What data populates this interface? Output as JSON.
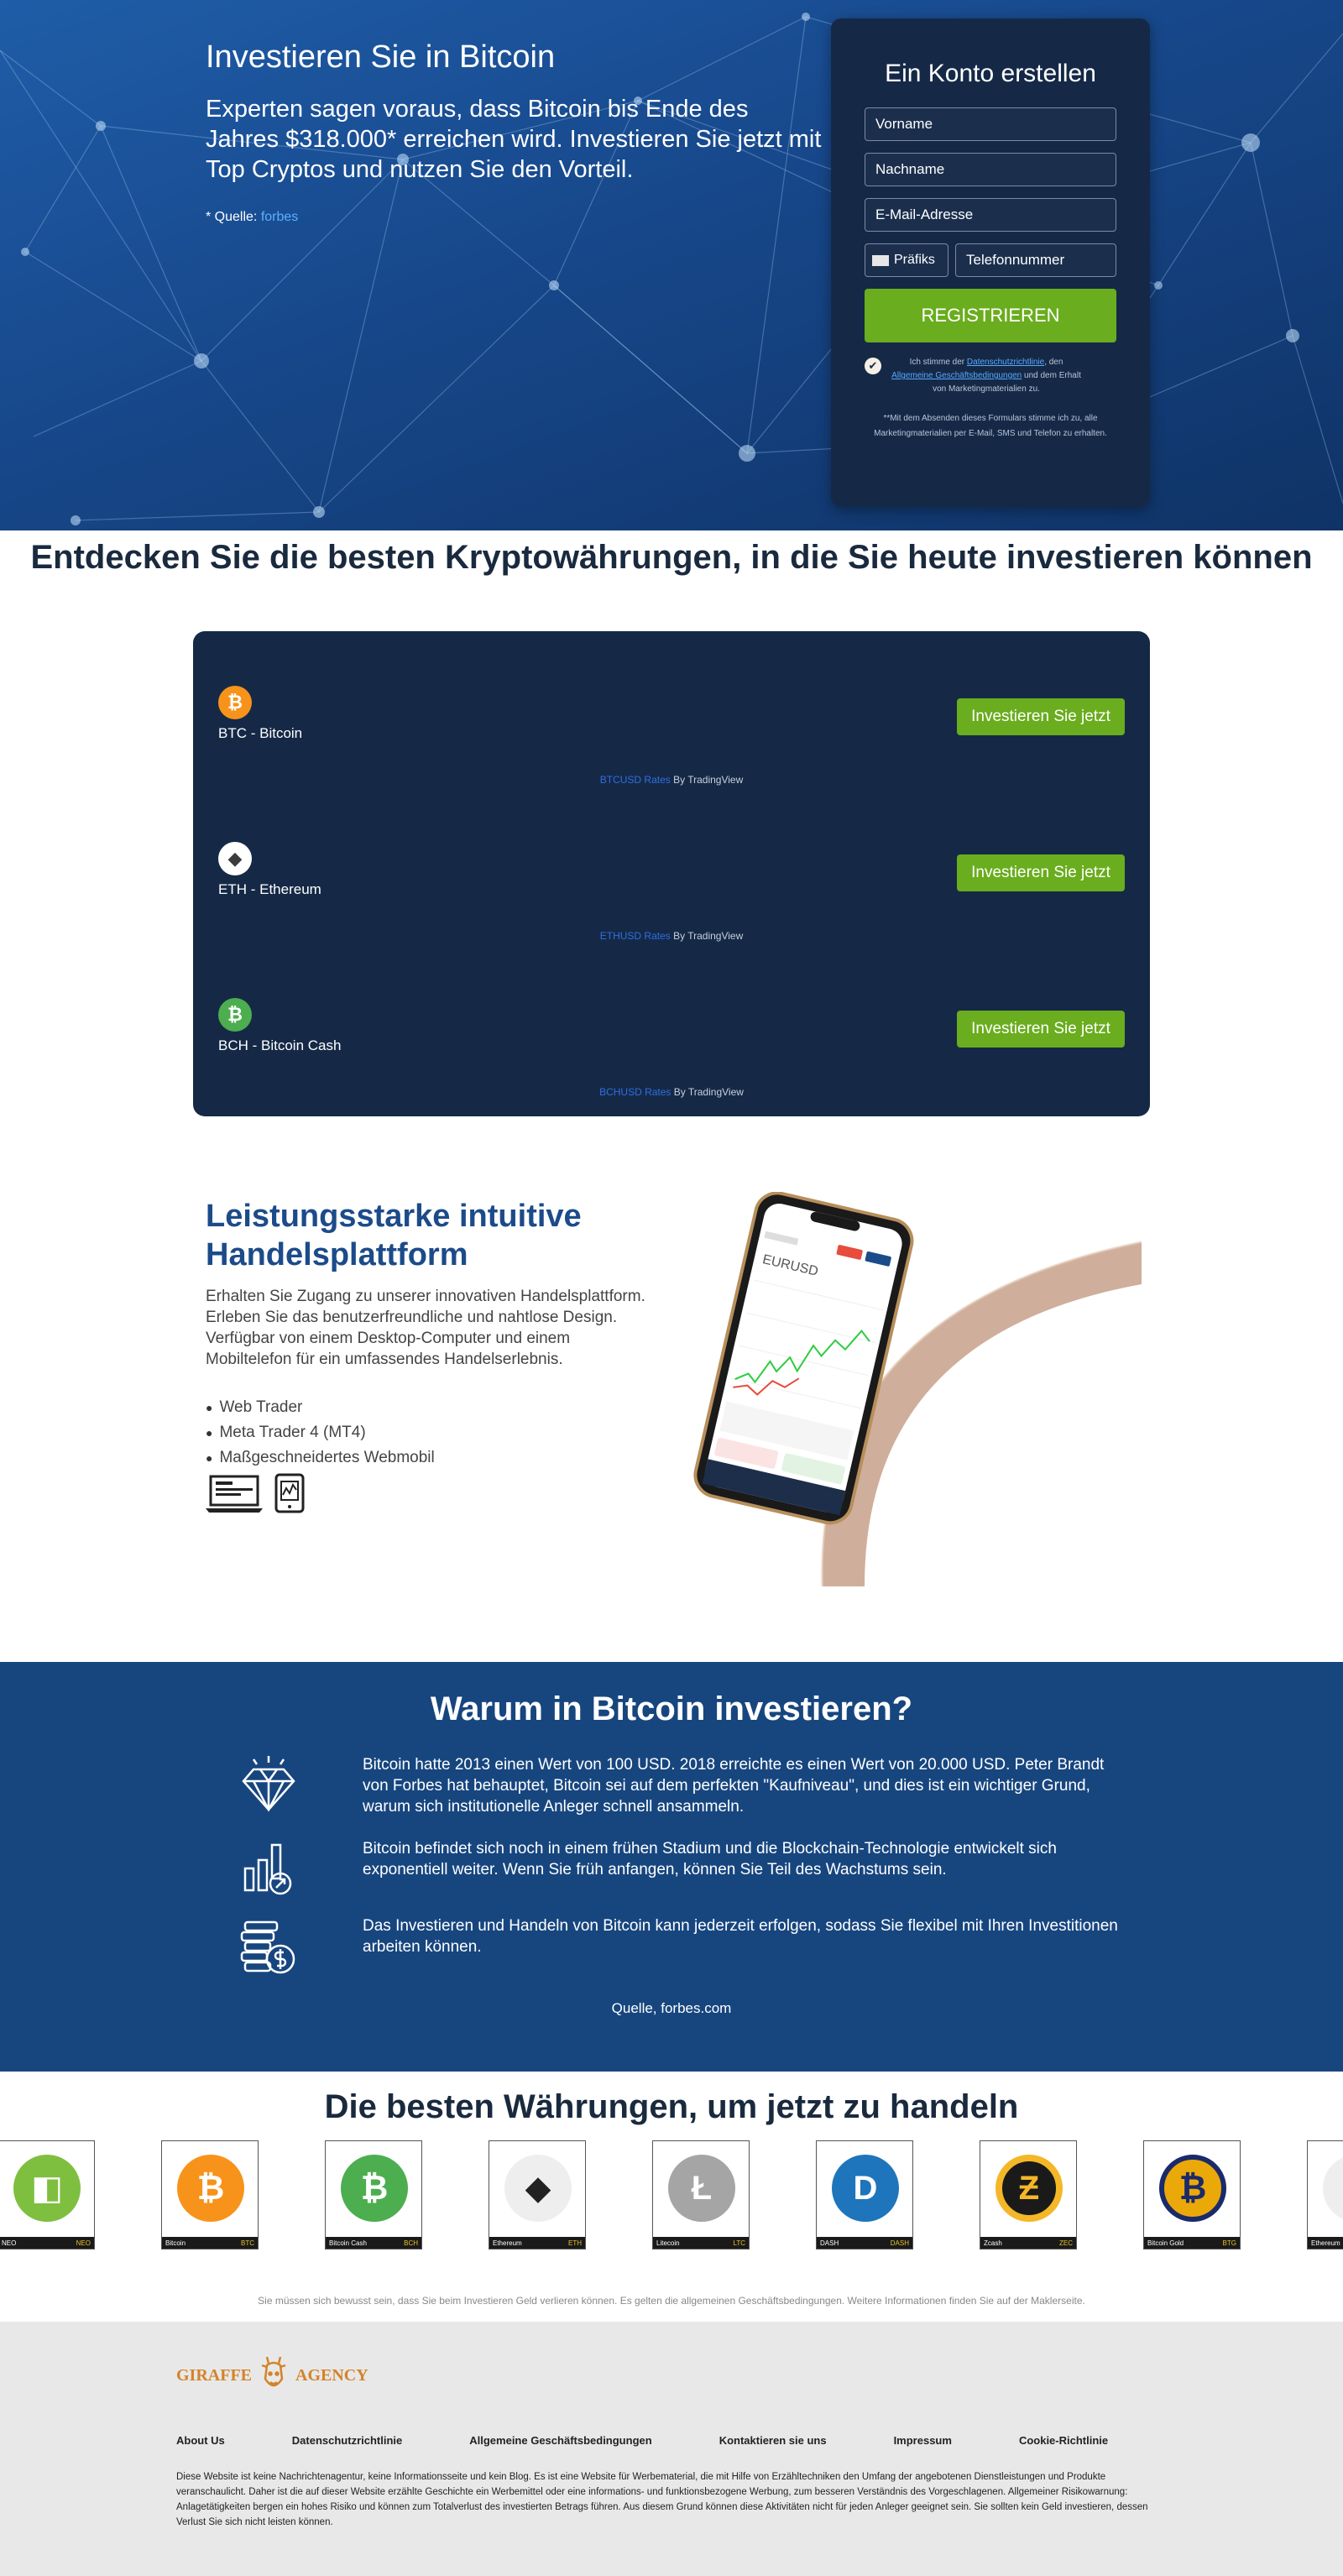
{
  "hero": {
    "title": "Investieren Sie in Bitcoin",
    "subtitle": "Experten sagen voraus, dass Bitcoin bis Ende des Jahres $318.000* erreichen wird. Investieren Sie jetzt mit Top Cryptos und nutzen Sie den Vorteil.",
    "source_prefix": "* Quelle: ",
    "source_link": "forbes"
  },
  "form": {
    "title": "Ein Konto erstellen",
    "first_name": "Vorname",
    "last_name": "Nachname",
    "email": "E-Mail-Adresse",
    "prefix": "Präfiks",
    "phone": "Telefonnummer",
    "submit": "REGISTRIEREN",
    "consent_1": "Ich stimme der ",
    "consent_link_1": "Datenschutzrichtlinie",
    "consent_2": ", den ",
    "consent_link_2": "Allgemeine Geschäftsbedingungen",
    "consent_3": " und dem Erhalt von Marketingmaterialien zu.",
    "notice": "**Mit dem Absenden dieses Formulars stimme ich zu, alle Marketingmaterialien per E-Mail, SMS und Telefon zu erhalten."
  },
  "discover": {
    "title": "Entdecken Sie die besten Kryptowährungen, in die Sie heute investieren können",
    "invest_label": "Investieren Sie jetzt",
    "by_label": " By TradingView",
    "coins": [
      {
        "name": "BTC - Bitcoin",
        "rates": "BTCUSD Rates",
        "color": "#f7931a",
        "glyph": "₿"
      },
      {
        "name": "ETH - Ethereum",
        "rates": "ETHUSD Rates",
        "color": "#ffffff",
        "glyph": "◆"
      },
      {
        "name": "BCH - Bitcoin Cash",
        "rates": "BCHUSD Rates",
        "color": "#4cae4f",
        "glyph": "₿"
      }
    ]
  },
  "platform": {
    "title": "Leistungsstarke intuitive Handelsplattform",
    "desc": "Erhalten Sie Zugang zu unserer innovativen Handelsplattform. Erleben Sie das benutzerfreundliche und nahtlose Design. Verfügbar von einem Desktop-Computer und einem Mobiltelefon für ein umfassendes Handelserlebnis.",
    "items": [
      "Web Trader",
      "Meta Trader 4 (MT4)",
      "Maßgeschneidertes Webmobil"
    ],
    "phone_pair": "EURUSD"
  },
  "why": {
    "title": "Warum in Bitcoin investieren?",
    "items": [
      "Bitcoin hatte 2013 einen Wert von 100 USD. 2018 erreichte es einen Wert von 20.000 USD. Peter Brandt von Forbes hat behauptet, Bitcoin sei auf dem perfekten \"Kaufniveau\", und dies ist ein wichtiger Grund, warum sich institutionelle Anleger schnell ansammeln.",
      "Bitcoin befindet sich noch in einem frühen Stadium und die Blockchain-Technologie entwickelt sich exponentiell weiter. Wenn Sie früh anfangen, können Sie Teil des Wachstums sein.",
      "Das Investieren und Handeln von Bitcoin kann jederzeit erfolgen, sodass Sie flexibel mit Ihren Investitionen arbeiten können."
    ],
    "source": "Quelle, forbes.com"
  },
  "currencies": {
    "title": "Die besten Währungen, um jetzt zu handeln",
    "cards": [
      {
        "name": "NEO",
        "ticker": "NEO",
        "color": "#7fbf3f",
        "glyph": "◧"
      },
      {
        "name": "Bitcoin",
        "ticker": "BTC",
        "color": "#f7931a",
        "glyph": "₿"
      },
      {
        "name": "Bitcoin Cash",
        "ticker": "BCH",
        "color": "#4cae4f",
        "glyph": "₿"
      },
      {
        "name": "Ethereum",
        "ticker": "ETH",
        "color": "#eeeeee",
        "glyph": "◆"
      },
      {
        "name": "Litecoin",
        "ticker": "LTC",
        "color": "#a5a5a5",
        "glyph": "Ł"
      },
      {
        "name": "DASH",
        "ticker": "DASH",
        "color": "#1e75bb",
        "glyph": "D"
      },
      {
        "name": "Zcash",
        "ticker": "ZEC",
        "color": "#f4b728",
        "glyph": "Ƶ"
      },
      {
        "name": "Bitcoin Gold",
        "ticker": "BTG",
        "color": "#eba809",
        "glyph": "₿"
      },
      {
        "name": "Ethereum",
        "ticker": "",
        "color": "#eeeeee",
        "glyph": "◆"
      }
    ]
  },
  "risk_line": "Sie müssen sich bewusst sein, dass Sie beim Investieren Geld verlieren können. Es gelten die allgemeinen Geschäftsbedingungen. Weitere Informationen finden Sie auf der Maklerseite.",
  "footer": {
    "logo_left": "GIRAFFE",
    "logo_right": "AGENCY",
    "links": [
      "About Us",
      "Datenschutzrichtlinie",
      "Allgemeine Geschäftsbedingungen",
      "Kontaktieren sie uns",
      "Impressum",
      "Cookie-Richtlinie"
    ],
    "disclaimer": "Diese Website ist keine Nachrichtenagentur, keine Informationsseite und kein Blog. Es ist eine Website für Werbematerial, die mit Hilfe von Erzähltechniken den Umfang der angebotenen Dienstleistungen und Produkte veranschaulicht. Daher ist die auf dieser Website erzählte Geschichte ein Werbemittel oder eine informations- und funktionsbezogene Werbung, zum besseren Verständnis des Vorgeschlagenen. Allgemeiner Risikowarnung: Anlagetätigkeiten bergen ein hohes Risiko und können zum Totalverlust des investierten Betrags führen. Aus diesem Grund können diese Aktivitäten nicht für jeden Anleger geeignet sein. Sie sollten kein Geld investieren, dessen Verlust Sie sich nicht leisten können."
  }
}
